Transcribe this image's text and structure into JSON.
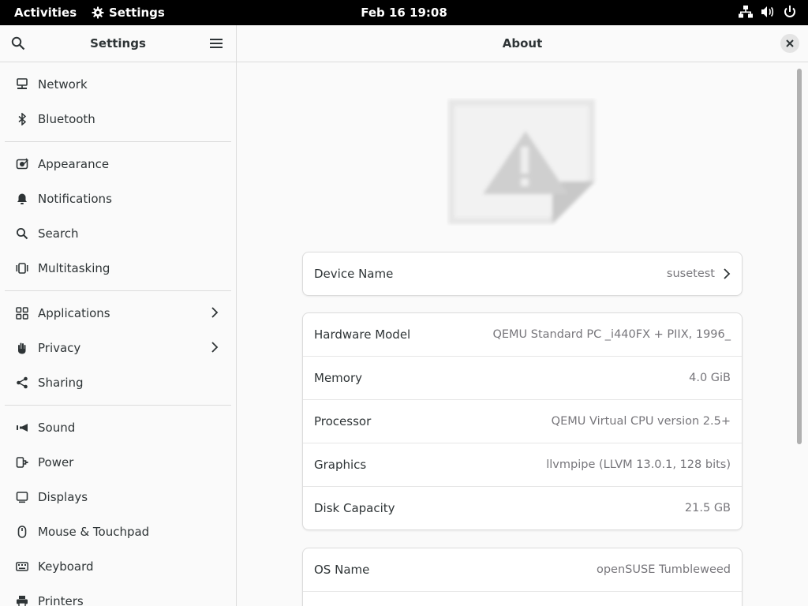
{
  "topbar": {
    "activities": "Activities",
    "app_name": "Settings",
    "clock": "Feb 16  19:08",
    "tray_icons": [
      "network-wired-icon",
      "volume-icon",
      "power-icon"
    ]
  },
  "sidebar": {
    "title": "Settings",
    "groups": [
      [
        {
          "label": "Network",
          "icon": "network-icon"
        },
        {
          "label": "Bluetooth",
          "icon": "bluetooth-icon"
        }
      ],
      [
        {
          "label": "Appearance",
          "icon": "appearance-icon"
        },
        {
          "label": "Notifications",
          "icon": "bell-icon"
        },
        {
          "label": "Search",
          "icon": "search-icon"
        },
        {
          "label": "Multitasking",
          "icon": "multitasking-icon"
        }
      ],
      [
        {
          "label": "Applications",
          "icon": "apps-grid-icon",
          "chevron": true
        },
        {
          "label": "Privacy",
          "icon": "hand-icon",
          "chevron": true
        },
        {
          "label": "Sharing",
          "icon": "share-icon"
        }
      ],
      [
        {
          "label": "Sound",
          "icon": "speaker-icon"
        },
        {
          "label": "Power",
          "icon": "power-plug-icon"
        },
        {
          "label": "Displays",
          "icon": "display-icon"
        },
        {
          "label": "Mouse & Touchpad",
          "icon": "mouse-icon"
        },
        {
          "label": "Keyboard",
          "icon": "keyboard-icon"
        },
        {
          "label": "Printers",
          "icon": "printer-icon"
        }
      ]
    ]
  },
  "main": {
    "title": "About",
    "device_card": [
      {
        "label": "Device Name",
        "value": "susetest",
        "chevron": true
      }
    ],
    "hardware_card": [
      {
        "label": "Hardware Model",
        "value": "QEMU Standard PC _i440FX + PIIX, 1996_"
      },
      {
        "label": "Memory",
        "value": "4.0 GiB"
      },
      {
        "label": "Processor",
        "value": "QEMU Virtual CPU version 2.5+"
      },
      {
        "label": "Graphics",
        "value": "llvmpipe (LLVM 13.0.1, 128 bits)"
      },
      {
        "label": "Disk Capacity",
        "value": "21.5 GB"
      }
    ],
    "os_card": [
      {
        "label": "OS Name",
        "value": "openSUSE Tumbleweed"
      }
    ]
  }
}
